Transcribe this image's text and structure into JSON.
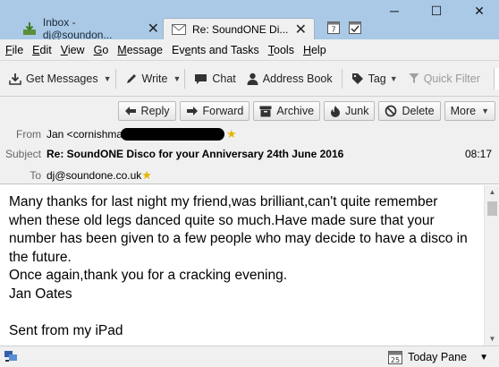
{
  "tabs": [
    {
      "label": "Inbox - dj@soundon...",
      "icon": "inbox-download-icon"
    },
    {
      "label": "Re: SoundONE Di...",
      "icon": "envelope-icon"
    }
  ],
  "menu": {
    "file": {
      "u": "F",
      "rest": "ile"
    },
    "edit": {
      "u": "E",
      "rest": "dit"
    },
    "view": {
      "u": "V",
      "rest": "iew"
    },
    "go": {
      "u": "G",
      "rest": "o"
    },
    "message": {
      "u": "M",
      "rest": "essage"
    },
    "events": {
      "pre": "Ev",
      "u": "e",
      "rest": "nts and Tasks"
    },
    "tools": {
      "u": "T",
      "rest": "ools"
    },
    "help": {
      "u": "H",
      "rest": "elp"
    }
  },
  "toolbar": {
    "get_messages": "Get Messages",
    "write": "Write",
    "chat": "Chat",
    "address_book": "Address Book",
    "tag": "Tag",
    "quick_filter": "Quick Filter"
  },
  "header_buttons": {
    "reply": "Reply",
    "forward": "Forward",
    "archive": "Archive",
    "junk": "Junk",
    "delete": "Delete",
    "more": "More"
  },
  "header": {
    "from_label": "From",
    "from_value": "Jan <cornishma",
    "subject_label": "Subject",
    "subject_value": "Re: SoundONE Disco for your Anniversary 24th June 2016",
    "to_label": "To",
    "to_value": "dj@soundone.co.uk",
    "time": "08:17"
  },
  "message_body": "Many thanks for last night my friend,was brilliant,can't quite remember\nwhen these old legs danced quite so much.Have made sure that your\nnumber has been given to a few people who may decide to have a disco in\nthe future.\nOnce again,thank you for a cracking evening.\nJan Oates\n\nSent from my iPad",
  "status": {
    "today_pane": "Today Pane",
    "calendar_day": "25"
  }
}
